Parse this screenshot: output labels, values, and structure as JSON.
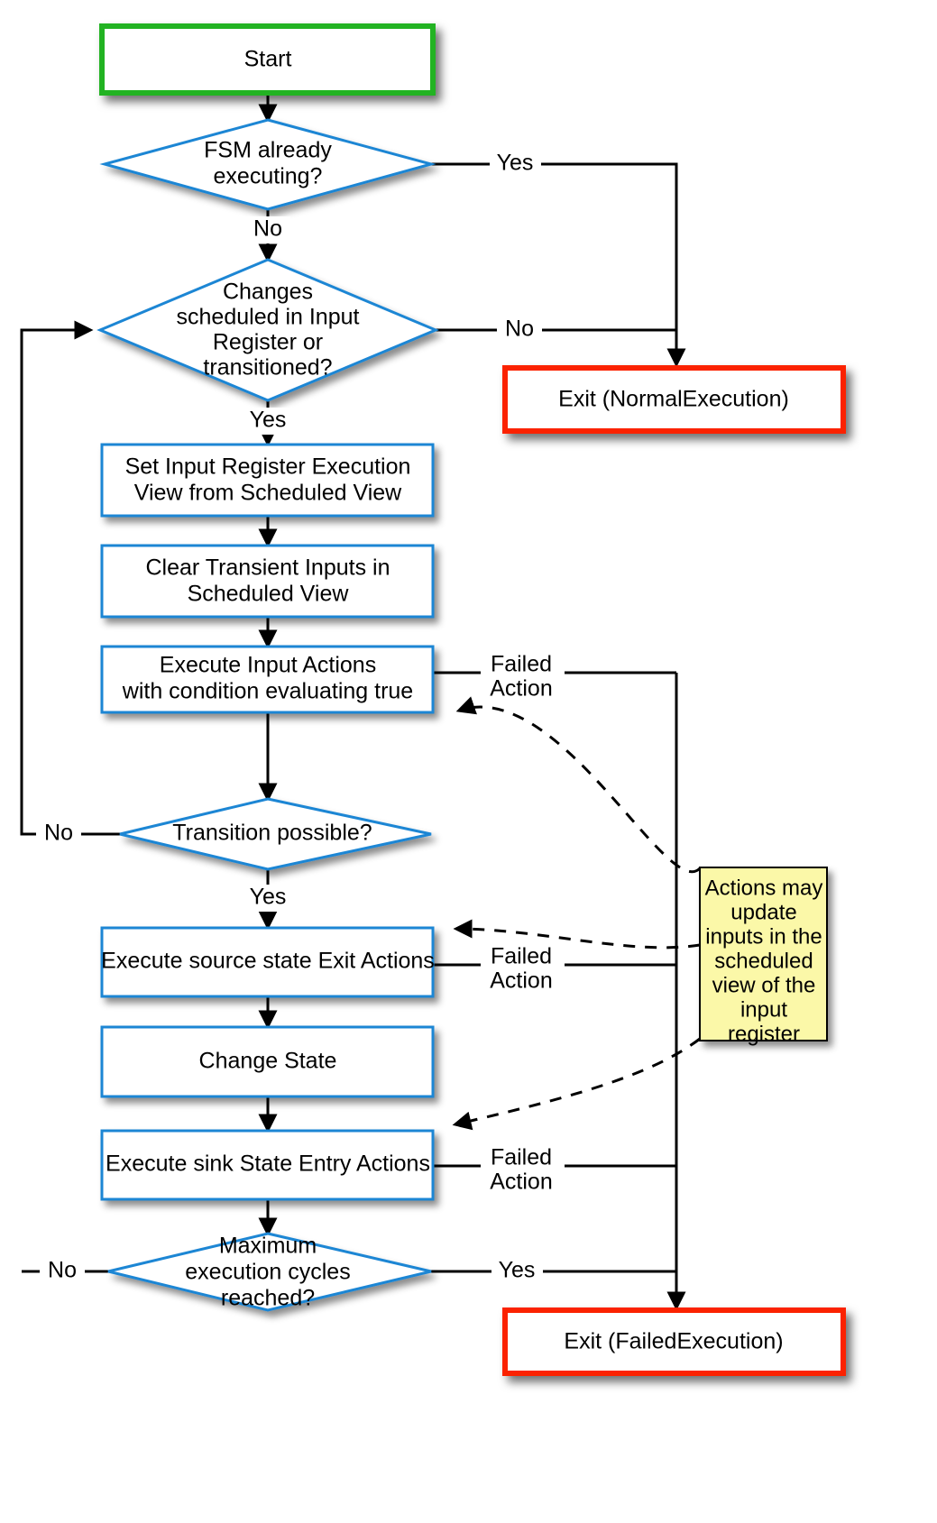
{
  "diagram": {
    "title_visible": false,
    "colors": {
      "start_border": "#24b324",
      "exit_border": "#fb2400",
      "process_border": "#1f86d4",
      "decision_border": "#1f86d4",
      "note_fill": "#fbf8a8",
      "note_border": "#000000",
      "flow_line": "#000000",
      "background": "#ffffff"
    },
    "nodes": {
      "start": {
        "label": "Start",
        "shape": "terminator"
      },
      "fsm_executing": {
        "label_line1": "FSM already",
        "label_line2": "executing?",
        "shape": "decision"
      },
      "changes_scheduled": {
        "label_line1": "Changes",
        "label_line2": "scheduled in Input",
        "label_line3": "Register or",
        "label_line4": "transitioned?",
        "shape": "decision"
      },
      "exit_normal": {
        "label": "Exit (NormalExecution)",
        "shape": "terminator"
      },
      "set_input_register": {
        "label_line1": "Set Input Register Execution",
        "label_line2": "View from Scheduled View",
        "shape": "process"
      },
      "clear_transient": {
        "label_line1": "Clear Transient Inputs in",
        "label_line2": "Scheduled View",
        "shape": "process"
      },
      "execute_input_actions": {
        "label_line1": "Execute Input Actions",
        "label_line2": "with condition evaluating true",
        "shape": "process"
      },
      "transition_possible": {
        "label": "Transition possible?",
        "shape": "decision"
      },
      "exit_actions": {
        "label": "Execute source state Exit Actions",
        "shape": "process"
      },
      "change_state": {
        "label": "Change State",
        "shape": "process"
      },
      "entry_actions": {
        "label": "Execute sink State Entry Actions",
        "shape": "process"
      },
      "max_cycles": {
        "label_line1": "Maximum",
        "label_line2": "execution cycles",
        "label_line3": "reached?",
        "shape": "decision"
      },
      "exit_failed": {
        "label": "Exit (FailedExecution)",
        "shape": "terminator"
      },
      "note": {
        "line1": "Actions may",
        "line2": "update",
        "line3": "inputs in the",
        "line4": "scheduled",
        "line5": "view of the",
        "line6": "input",
        "line7": "register",
        "shape": "note"
      }
    },
    "edge_labels": {
      "fsm_yes": "Yes",
      "fsm_no": "No",
      "changes_no": "No",
      "changes_yes": "Yes",
      "transition_no": "No",
      "transition_yes": "Yes",
      "failed_action_1_line1": "Failed",
      "failed_action_1_line2": "Action",
      "failed_action_2_line1": "Failed",
      "failed_action_2_line2": "Action",
      "failed_action_3_line1": "Failed",
      "failed_action_3_line2": "Action",
      "max_no": "No",
      "max_yes": "Yes"
    }
  }
}
